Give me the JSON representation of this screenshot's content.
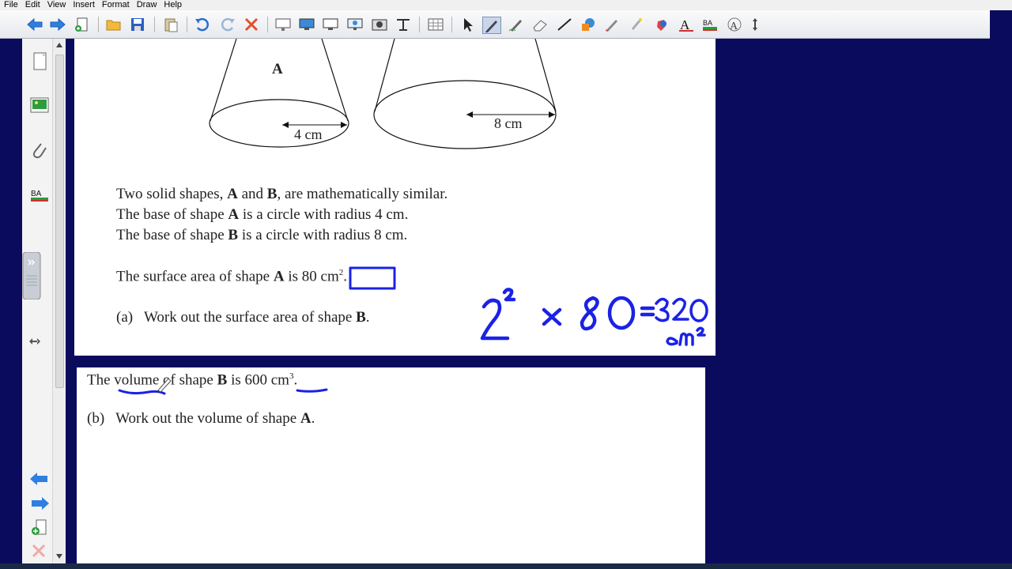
{
  "menu": [
    "File",
    "Edit",
    "View",
    "Insert",
    "Format",
    "Draw",
    "Help"
  ],
  "toolbar_icons": [
    "back-arrow-icon",
    "forward-arrow-icon",
    "new-page-icon",
    "open-folder-icon",
    "save-icon",
    "paste-icon",
    "undo-icon",
    "redo-icon",
    "delete-icon",
    "screen-shade-icon",
    "display-icon",
    "monitor-icon",
    "projector-icon",
    "camera-icon",
    "table-tool-icon",
    "table-icon",
    "select-arrow-icon",
    "pen-icon",
    "creative-pen-icon",
    "eraser-icon",
    "line-icon",
    "shapes-icon",
    "magic-pen-icon",
    "fill-icon",
    "highlighter-icon",
    "text-icon",
    "properties-icon",
    "measure-icon",
    "move-toolbar-icon"
  ],
  "colors": {
    "background": "#0b0b5e",
    "ink": "#1a22e6"
  },
  "page1": {
    "label_A": "A",
    "dim_A": "4 cm",
    "dim_B": "8 cm",
    "line1_a": "Two solid shapes, ",
    "line1_b": "A",
    "line1_c": " and ",
    "line1_d": "B",
    "line1_e": ", are mathematically similar.",
    "line2_a": "The base of shape ",
    "line2_b": "A",
    "line2_c": " is a circle with radius 4 cm.",
    "line3_a": "The base of shape ",
    "line3_b": "B",
    "line3_c": " is a circle with radius 8 cm.",
    "line4_a": "The surface area of shape ",
    "line4_b": "A",
    "line4_c": " is 80 ",
    "line4_unit": "cm",
    "line4_sup": "2",
    "line4_end": ".",
    "q_a_num": "(a)",
    "q_a_text": "Work out the surface area of shape ",
    "q_a_bold": "B",
    "q_a_end": "."
  },
  "handwriting": {
    "calc": "2² × 80 =320",
    "unit": "cm²"
  },
  "page2": {
    "line1_a": "The volume of shape ",
    "line1_b": "B",
    "line1_c": " is 600 ",
    "line1_unit": "cm",
    "line1_sup": "3",
    "line1_end": ".",
    "q_b_num": "(b)",
    "q_b_text": "Work out the volume of shape ",
    "q_b_bold": "A",
    "q_b_end": "."
  }
}
